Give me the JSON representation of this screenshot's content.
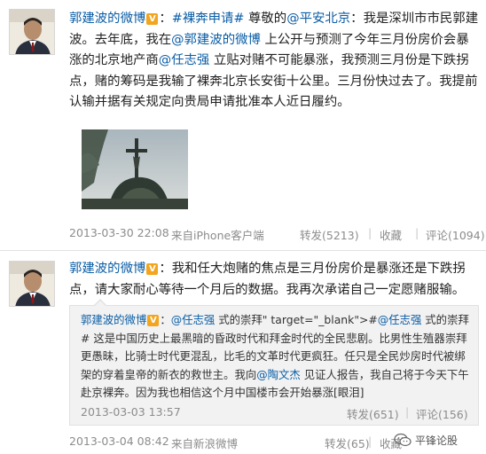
{
  "posts": [
    {
      "author": "郭建波的微博",
      "verified_badge": "V",
      "text_segments": [
        {
          "t": "：",
          "link": false
        },
        {
          "t": "#裸奔申请#",
          "link": true
        },
        {
          "t": " 尊敬的",
          "link": false
        },
        {
          "t": "@平安北京",
          "link": true
        },
        {
          "t": "：我是深圳市市民郭建波。去年底，我在",
          "link": false
        },
        {
          "t": "@郭建波的微博",
          "link": true
        },
        {
          "t": " 上公开与预测了今年三月份房价会暴涨的北京地产商",
          "link": false
        },
        {
          "t": "@任志强",
          "link": true
        },
        {
          "t": " 立贴对赌不可能暴涨，我预测三月份是下跌拐点，赌的筹码是我输了裸奔北京长安街十公里。三月份快过去了。我提前认输并据有关规定向贵局申请批准本人近日履约。",
          "link": false
        }
      ],
      "time": "2013-03-30 22:08",
      "source": "来自iPhone客户端",
      "actions": {
        "repost": "转发(5213)",
        "favorite": "收藏",
        "comment": "评论(1094)"
      }
    },
    {
      "author": "郭建波的微博",
      "verified_badge": "V",
      "text_segments": [
        {
          "t": "：我和任大炮赌的焦点是三月份房价是暴涨还是下跌拐点，请大家耐心等待一个月后的数据。我再次承诺自己一定愿赌服输。",
          "link": false
        }
      ],
      "repost": {
        "author": "郭建波的微博",
        "verified_badge": "V",
        "text_segments": [
          {
            "t": "：",
            "link": false
          },
          {
            "t": "@任志强",
            "link": true
          },
          {
            "t": " 式的崇拜\" target=\"_blank\">#",
            "link": false
          },
          {
            "t": "@任志强",
            "link": true
          },
          {
            "t": " 式的崇拜# 这是中国历史上最黑暗的昏政时代和拜金时代的全民悲剧。比男性生殖器崇拜更愚昧，比骑士时代更混乱，比毛的文革时代更疯狂。任只是全民炒房时代被绑架的穿着皇帝的新衣的救世主。我向",
            "link": false
          },
          {
            "t": "@陶文杰",
            "link": true
          },
          {
            "t": " 见证人报告，我自己将于今天下午赴京裸奔。因为我也相信这个月中国楼市会开始暴涨[眼泪]",
            "link": false
          }
        ],
        "time": "2013-03-03 13:57",
        "actions": {
          "repost": "转发(651)",
          "comment": "评论(156)"
        }
      },
      "time": "2013-03-04 08:42",
      "source": "来自新浪微博",
      "actions": {
        "repost": "转发(65)",
        "favorite": "收藏",
        "comment": "评论(65)"
      }
    }
  ],
  "watermark": {
    "text": "平锋论股"
  },
  "colors": {
    "link": "#0a5da6",
    "meta": "#8c8c8c",
    "badge": "#f3a51d",
    "repost_bg": "#f2f2f2"
  },
  "icons": [
    "avatar-portrait",
    "verified-v-icon",
    "church-cross-photo",
    "wechat-icon"
  ]
}
